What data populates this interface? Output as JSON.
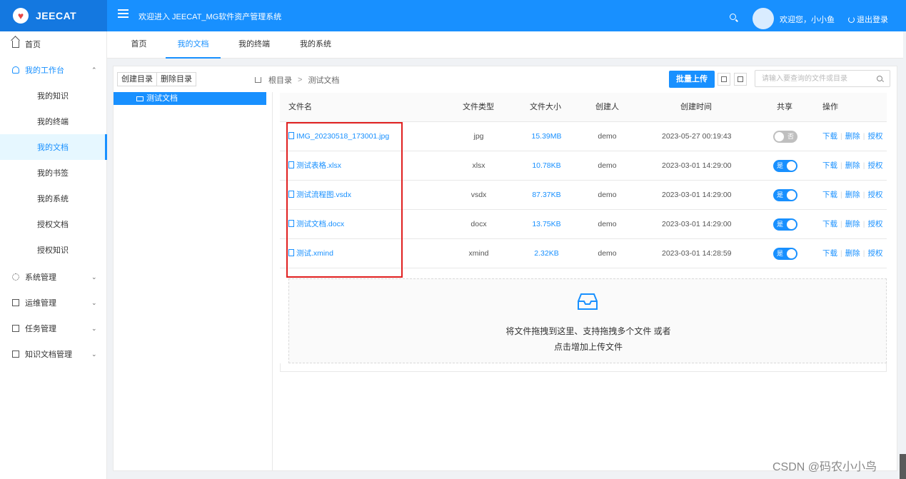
{
  "app": {
    "logo_text": "JEECAT",
    "welcome": "欢迎进入 JEECAT_MG软件资产管理系统",
    "greeting": "欢迎您，小小鱼",
    "logout": "退出登录"
  },
  "sidebar": {
    "home": "首页",
    "workbench": "我的工作台",
    "sub_items": [
      "我的知识",
      "我的终端",
      "我的文档",
      "我的书签",
      "我的系统",
      "授权文档",
      "授权知识"
    ],
    "system_mgmt": "系统管理",
    "ops_mgmt": "运维管理",
    "task_mgmt": "任务管理",
    "kb_mgmt": "知识文档管理"
  },
  "tabs": [
    "首页",
    "我的文档",
    "我的终端",
    "我的系统"
  ],
  "toolbar": {
    "create_dir": "创建目录",
    "delete_dir": "删除目录",
    "batch_upload": "批量上传",
    "search_placeholder": "请输入要查询的文件或目录"
  },
  "breadcrumb": {
    "root": "根目录",
    "sep": ">",
    "current": "测试文档"
  },
  "tree": {
    "node": "测试文档"
  },
  "table": {
    "headers": {
      "name": "文件名",
      "type": "文件类型",
      "size": "文件大小",
      "creator": "创建人",
      "created": "创建时间",
      "share": "共享",
      "ops": "操作"
    },
    "rows": [
      {
        "name": "IMG_20230518_173001.jpg",
        "type": "jpg",
        "size": "15.39MB",
        "creator": "demo",
        "created": "2023-05-27 00:19:43",
        "share_label": "否"
      },
      {
        "name": "测试表格.xlsx",
        "type": "xlsx",
        "size": "10.78KB",
        "creator": "demo",
        "created": "2023-03-01 14:29:00",
        "share_label": "是"
      },
      {
        "name": "测试流程图.vsdx",
        "type": "vsdx",
        "size": "87.37KB",
        "creator": "demo",
        "created": "2023-03-01 14:29:00",
        "share_label": "是"
      },
      {
        "name": "测试文档.docx",
        "type": "docx",
        "size": "13.75KB",
        "creator": "demo",
        "created": "2023-03-01 14:29:00",
        "share_label": "是"
      },
      {
        "name": "测试.xmind",
        "type": "xmind",
        "size": "2.32KB",
        "creator": "demo",
        "created": "2023-03-01 14:28:59",
        "share_label": "是"
      }
    ],
    "ops": {
      "download": "下载",
      "delete": "删除",
      "grant": "授权",
      "divider": "|"
    }
  },
  "dropzone": {
    "line1": "将文件拖拽到这里、支持拖拽多个文件 或者",
    "line2": "点击增加上传文件"
  },
  "watermark": "CSDN @码农小小鸟",
  "colors": {
    "primary": "#1890ff",
    "highlight": "#e02020"
  }
}
